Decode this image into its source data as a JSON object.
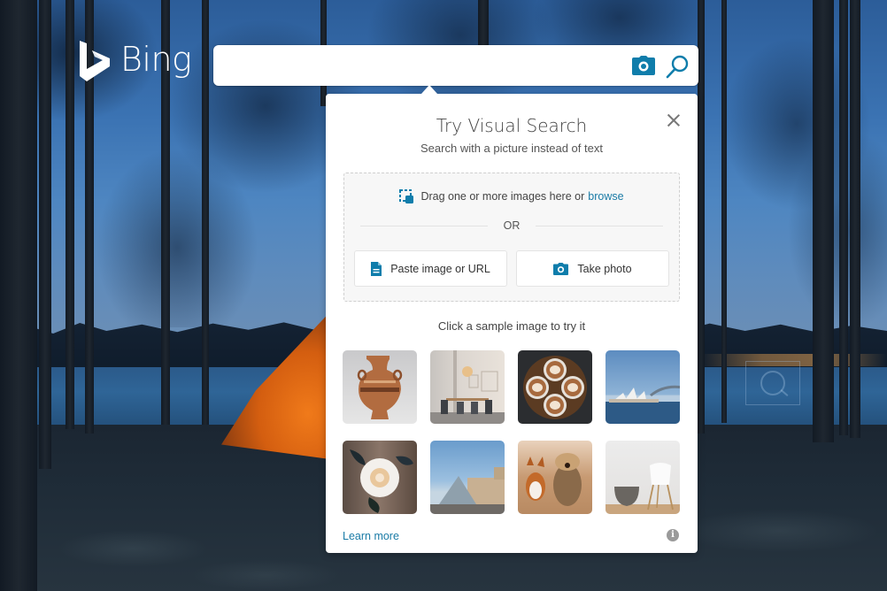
{
  "logo": {
    "text": "Bing"
  },
  "search": {
    "placeholder": "",
    "value": "",
    "camera_icon": "camera-icon",
    "search_icon": "search-icon"
  },
  "colors": {
    "accent": "#0f7dab",
    "link": "#1a7ba6",
    "panel_bg": "#ffffff",
    "dropzone_bg": "#f7f7f7"
  },
  "visual_search": {
    "title": "Try Visual Search",
    "subtitle": "Search with a picture instead of text",
    "drag_text": "Drag one or more images here or",
    "browse_label": "browse",
    "or_label": "OR",
    "paste_label": "Paste image or URL",
    "photo_label": "Take photo",
    "sample_label": "Click a sample image to try it",
    "samples": [
      {
        "name": "ancient-vase"
      },
      {
        "name": "dining-room"
      },
      {
        "name": "latte-art-cups"
      },
      {
        "name": "sydney-opera-house"
      },
      {
        "name": "white-rose"
      },
      {
        "name": "louvre-pyramid"
      },
      {
        "name": "dogs-running"
      },
      {
        "name": "white-chair-basket"
      }
    ],
    "learn_more_label": "Learn more",
    "info_icon": "i"
  }
}
